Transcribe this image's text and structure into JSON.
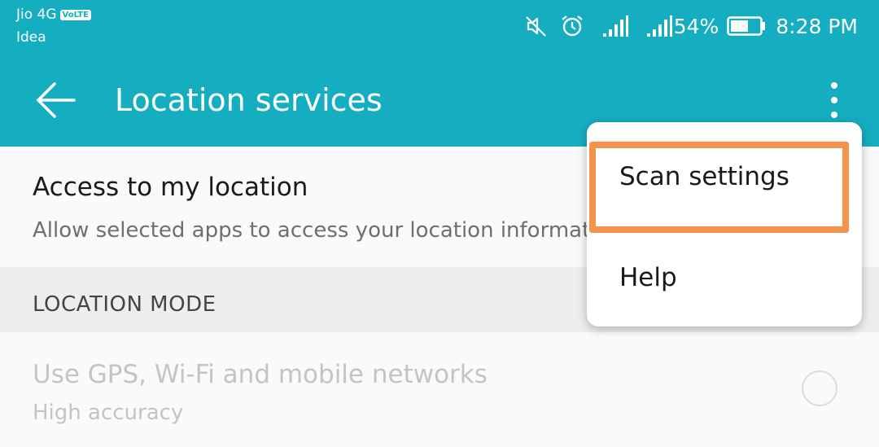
{
  "status_bar": {
    "carrier_primary": "Jio 4G",
    "volte_badge": "VoLTE",
    "carrier_secondary": "Idea",
    "icons": [
      "mute-icon",
      "alarm-icon",
      "signal-icon",
      "signal-icon"
    ],
    "battery": "54%",
    "time": "8:28 PM"
  },
  "app_bar": {
    "title": "Location services",
    "back_icon": "arrow-left-icon",
    "more_icon": "more-vertical-icon"
  },
  "access_item": {
    "title": "Access to my location",
    "subtitle": "Allow selected apps to access your location informati"
  },
  "location_mode": {
    "header": "LOCATION MODE",
    "option_title": "Use GPS, Wi-Fi and mobile networks",
    "option_subtitle": "High accuracy"
  },
  "overflow_menu": {
    "items": [
      {
        "label": "Scan settings"
      },
      {
        "label": "Help"
      }
    ]
  },
  "colors": {
    "primary": "#15aec1",
    "highlight": "#f4934b",
    "disabled_text": "#c4c4c4"
  }
}
